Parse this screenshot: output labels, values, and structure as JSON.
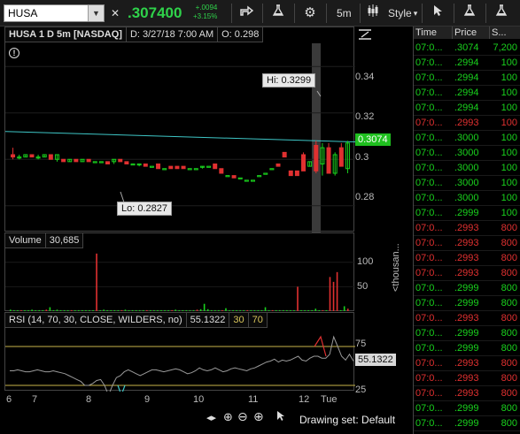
{
  "toolbar": {
    "symbol": "HUSA",
    "last": ".307400",
    "net_change": "+.0094",
    "pct_change": "+3.15%",
    "timeframe": "5m",
    "style_label": "Style"
  },
  "chart": {
    "title": "HUSA 1 D 5m [NASDAQ]",
    "date_info": "D: 3/27/18 7:00 AM",
    "open_info": "O: 0.298",
    "hi_label": "Hi: 0.3299",
    "lo_label": "Lo: 0.2827",
    "price_tag": "0.3074",
    "price_axis": [
      "0.34",
      "0.32",
      "0.3",
      "0.28"
    ],
    "x_axis": [
      "6",
      "7",
      "8",
      "9",
      "10",
      "11",
      "12",
      "Tue"
    ],
    "volume_label": "Volume",
    "volume_value": "30,685",
    "volume_axis": [
      "100",
      "50"
    ],
    "volume_unit": "<thousan...",
    "rsi_label": "RSI (14, 70, 30, CLOSE, WILDERS, no)",
    "rsi_value": "55.1322",
    "rsi_ob": "30",
    "rsi_os": "70",
    "rsi_axis": [
      "75",
      "25"
    ],
    "rsi_tag": "55.1322",
    "drawing_set": "Drawing set: Default"
  },
  "chart_data": {
    "type": "candlestick",
    "ylim": [
      0.27,
      0.35
    ],
    "candles": [
      [
        0.302,
        0.305,
        0.3,
        0.301
      ],
      [
        0.301,
        0.302,
        0.3,
        0.301
      ],
      [
        0.301,
        0.302,
        0.301,
        0.302
      ],
      [
        0.302,
        0.302,
        0.301,
        0.301
      ],
      [
        0.301,
        0.302,
        0.3,
        0.301
      ],
      [
        0.301,
        0.302,
        0.301,
        0.302
      ],
      [
        0.302,
        0.302,
        0.3,
        0.3
      ],
      [
        0.3,
        0.302,
        0.299,
        0.302
      ],
      [
        0.3,
        0.3,
        0.299,
        0.299
      ],
      [
        0.299,
        0.3,
        0.299,
        0.3
      ],
      [
        0.3,
        0.3,
        0.299,
        0.299
      ],
      [
        0.299,
        0.3,
        0.299,
        0.3
      ],
      [
        0.3,
        0.3,
        0.299,
        0.299
      ],
      [
        0.299,
        0.299,
        0.299,
        0.299
      ],
      [
        0.299,
        0.299,
        0.299,
        0.299
      ],
      [
        0.299,
        0.299,
        0.298,
        0.298
      ],
      [
        0.299,
        0.3,
        0.298,
        0.3
      ],
      [
        0.3,
        0.3,
        0.299,
        0.299
      ],
      [
        0.299,
        0.299,
        0.298,
        0.298
      ],
      [
        0.298,
        0.298,
        0.298,
        0.298
      ],
      [
        0.298,
        0.298,
        0.297,
        0.298
      ],
      [
        0.298,
        0.298,
        0.297,
        0.297
      ],
      [
        0.297,
        0.297,
        0.297,
        0.297
      ],
      [
        0.298,
        0.298,
        0.296,
        0.296
      ],
      [
        0.296,
        0.296,
        0.296,
        0.296
      ],
      [
        0.297,
        0.297,
        0.296,
        0.296
      ],
      [
        0.297,
        0.297,
        0.296,
        0.296
      ],
      [
        0.297,
        0.297,
        0.296,
        0.296
      ],
      [
        0.296,
        0.296,
        0.296,
        0.296
      ],
      [
        0.296,
        0.296,
        0.296,
        0.296
      ],
      [
        0.297,
        0.297,
        0.296,
        0.297
      ],
      [
        0.297,
        0.297,
        0.297,
        0.297
      ],
      [
        0.298,
        0.298,
        0.296,
        0.296
      ],
      [
        0.296,
        0.296,
        0.294,
        0.294
      ],
      [
        0.293,
        0.293,
        0.293,
        0.293
      ],
      [
        0.293,
        0.293,
        0.292,
        0.292
      ],
      [
        0.292,
        0.292,
        0.292,
        0.292
      ],
      [
        0.291,
        0.291,
        0.291,
        0.291
      ],
      [
        0.291,
        0.291,
        0.291,
        0.291
      ],
      [
        0.293,
        0.293,
        0.293,
        0.293
      ],
      [
        0.294,
        0.294,
        0.294,
        0.294
      ],
      [
        0.296,
        0.296,
        0.296,
        0.296
      ],
      [
        0.298,
        0.298,
        0.297,
        0.297
      ],
      [
        0.303,
        0.303,
        0.301,
        0.301
      ],
      [
        0.295,
        0.295,
        0.293,
        0.293
      ],
      [
        0.295,
        0.295,
        0.293,
        0.293
      ],
      [
        0.302,
        0.303,
        0.295,
        0.295
      ],
      [
        0.297,
        0.299,
        0.297,
        0.299
      ],
      [
        0.306,
        0.308,
        0.294,
        0.295
      ],
      [
        0.298,
        0.307,
        0.293,
        0.305
      ],
      [
        0.305,
        0.307,
        0.294,
        0.294
      ],
      [
        0.294,
        0.303,
        0.293,
        0.302
      ],
      [
        0.305,
        0.307,
        0.297,
        0.297
      ],
      [
        0.296,
        0.308,
        0.294,
        0.307
      ]
    ],
    "volume": [
      3,
      2,
      2,
      2,
      2,
      2,
      3,
      2,
      2,
      2,
      3,
      8,
      2,
      3,
      2,
      2,
      2,
      2,
      2,
      2,
      2,
      2,
      2,
      2,
      118,
      2,
      3,
      2,
      2,
      2,
      2,
      2,
      3,
      2,
      2,
      2,
      2,
      2,
      2,
      2,
      2,
      2,
      2,
      2,
      2,
      2,
      3,
      2,
      2,
      2,
      2,
      2,
      3,
      4,
      15,
      4,
      2,
      2,
      2,
      2,
      6,
      2,
      2,
      2,
      2,
      2,
      2,
      2,
      2,
      2,
      2,
      8,
      2,
      2,
      2,
      2,
      2,
      2,
      2,
      2,
      50,
      2,
      2,
      2,
      2,
      5,
      2,
      2,
      2,
      70,
      60,
      80,
      2,
      10,
      5
    ],
    "vol_ylim": [
      0,
      125
    ],
    "rsi": [
      45,
      45,
      46,
      45,
      44,
      44,
      45,
      46,
      45,
      44,
      44,
      45,
      44,
      43,
      42,
      40,
      38,
      36,
      34,
      30,
      30,
      32,
      35,
      36,
      30,
      20,
      30,
      38,
      40,
      44,
      46,
      44,
      42,
      40,
      42,
      44,
      46,
      46,
      45,
      44,
      45,
      46,
      47,
      46,
      44,
      42,
      43,
      45,
      48,
      46,
      45,
      46,
      48,
      46,
      44,
      45,
      47,
      48,
      47,
      46,
      45,
      47,
      48,
      50,
      52,
      54,
      55,
      57,
      54,
      56,
      55,
      56,
      58,
      60,
      56,
      55,
      58,
      60,
      60,
      58,
      58,
      62,
      80,
      70,
      60,
      56,
      62,
      55
    ],
    "rsi_ylim": [
      0,
      100
    ],
    "ma": [
      0.312,
      0.3075
    ]
  },
  "tns": {
    "headers": [
      "Time",
      "Price",
      "S..."
    ],
    "rows": [
      [
        "07:0...",
        ".3074",
        "7,200",
        "up"
      ],
      [
        "07:0...",
        ".2994",
        "100",
        "up"
      ],
      [
        "07:0...",
        ".2994",
        "100",
        "up"
      ],
      [
        "07:0...",
        ".2994",
        "100",
        "up"
      ],
      [
        "07:0...",
        ".2994",
        "100",
        "up"
      ],
      [
        "07:0...",
        ".2993",
        "100",
        "dn"
      ],
      [
        "07:0...",
        ".3000",
        "100",
        "up"
      ],
      [
        "07:0...",
        ".3000",
        "100",
        "up"
      ],
      [
        "07:0...",
        ".3000",
        "100",
        "up"
      ],
      [
        "07:0...",
        ".3000",
        "100",
        "up"
      ],
      [
        "07:0...",
        ".3000",
        "100",
        "up"
      ],
      [
        "07:0...",
        ".2999",
        "100",
        "up"
      ],
      [
        "07:0...",
        ".2993",
        "800",
        "dn"
      ],
      [
        "07:0...",
        ".2993",
        "800",
        "dn"
      ],
      [
        "07:0...",
        ".2993",
        "800",
        "dn"
      ],
      [
        "07:0...",
        ".2993",
        "800",
        "dn"
      ],
      [
        "07:0...",
        ".2999",
        "800",
        "up"
      ],
      [
        "07:0...",
        ".2999",
        "800",
        "up"
      ],
      [
        "07:0...",
        ".2993",
        "800",
        "dn"
      ],
      [
        "07:0...",
        ".2999",
        "800",
        "up"
      ],
      [
        "07:0...",
        ".2999",
        "800",
        "up"
      ],
      [
        "07:0...",
        ".2993",
        "800",
        "dn"
      ],
      [
        "07:0...",
        ".2993",
        "800",
        "dn"
      ],
      [
        "07:0...",
        ".2993",
        "800",
        "dn"
      ],
      [
        "07:0...",
        ".2999",
        "800",
        "up"
      ],
      [
        "07:0...",
        ".2999",
        "800",
        "up"
      ],
      [
        "07:0...",
        ".2993",
        "800",
        "dn"
      ]
    ]
  },
  "colors": {
    "up": "#19d21d",
    "down": "#e03030",
    "ma": "#3ec6c6",
    "rsi_band": "#c9b44a",
    "rsi_line": "#9a9a9a"
  }
}
